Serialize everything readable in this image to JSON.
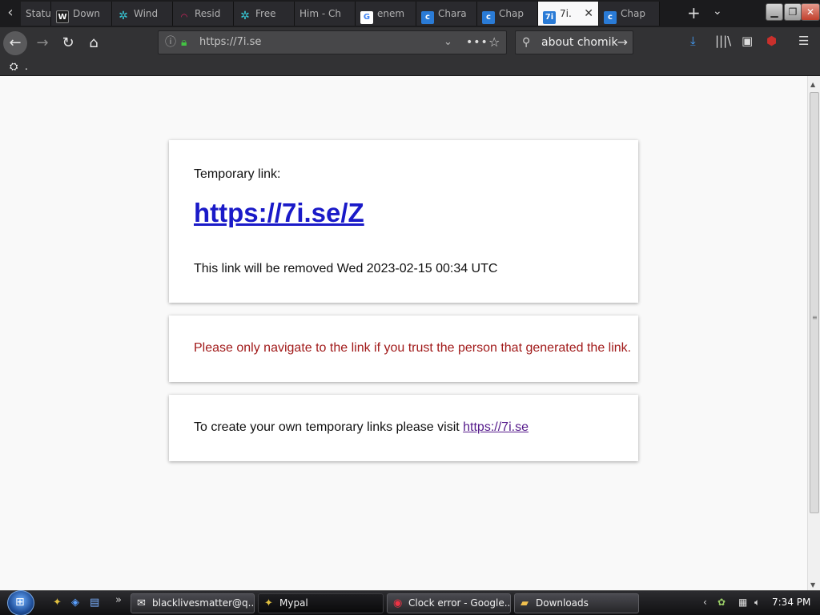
{
  "browser": {
    "tabs": [
      {
        "label": "Statu",
        "icon": "tab-icon-generic"
      },
      {
        "label": "Down",
        "icon": "wordpress-icon"
      },
      {
        "label": "Wind",
        "icon": "cyan-puzzle-icon"
      },
      {
        "label": "Resid",
        "icon": "rainbow-icon"
      },
      {
        "label": "Free",
        "icon": "cyan-puzzle-icon"
      },
      {
        "label": "Him - Ch",
        "icon": "none"
      },
      {
        "label": "enem",
        "icon": "google-icon"
      },
      {
        "label": "Chara",
        "icon": "cf-icon"
      },
      {
        "label": "Chap",
        "icon": "cf-icon"
      },
      {
        "label": "7i.",
        "icon": "7i-icon",
        "active": true
      },
      {
        "label": "Chap",
        "icon": "cf-icon"
      }
    ],
    "favicon_7i": "7i",
    "url": "https://7i.se",
    "search_text": "about chomik",
    "bookmark_label": "."
  },
  "page": {
    "temporary_label": "Temporary link:",
    "temporary_link": "https://7i.se/Z",
    "expiry_text": "This link will be removed Wed 2023-02-15 00:34 UTC",
    "warning_text": "Please only navigate to the link if you trust the person that generated the link.",
    "create_prefix": "To create your own temporary links please visit ",
    "create_link": "https://7i.se"
  },
  "taskbar": {
    "tasks": [
      {
        "label": "blacklivesmatter@q...",
        "icon": "mail-icon"
      },
      {
        "label": "Mypal",
        "icon": "mypal-icon",
        "active": true
      },
      {
        "label": "Clock error - Google...",
        "icon": "chrome-icon"
      },
      {
        "label": "Downloads",
        "icon": "folder-icon"
      }
    ],
    "clock": "7:34 PM"
  },
  "colors": {
    "link_blue": "#1a1ac8",
    "warning_red": "#a11a1a",
    "visited_link": "#551a8b",
    "tabstrip_bg": "#1b1b1d",
    "navbar_bg": "#323234",
    "page_bg": "#f9f9f9"
  }
}
